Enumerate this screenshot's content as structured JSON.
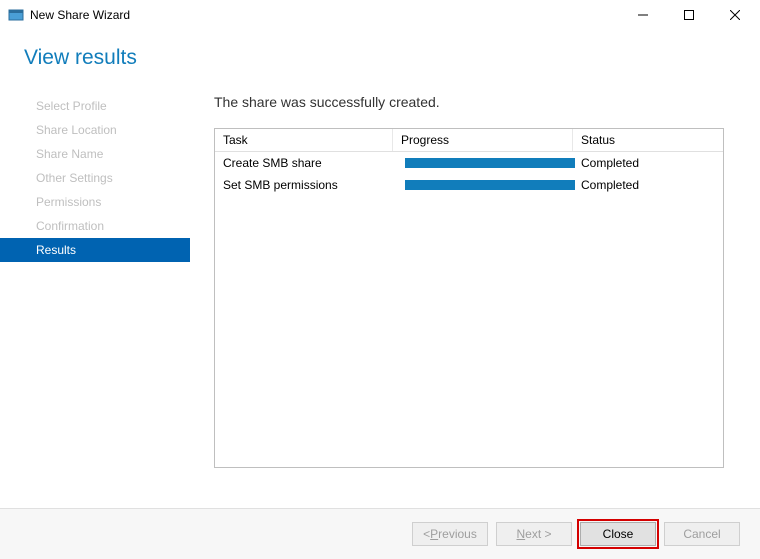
{
  "window": {
    "title": "New Share Wizard"
  },
  "heading": "View results",
  "sidebar": {
    "items": [
      {
        "label": "Select Profile"
      },
      {
        "label": "Share Location"
      },
      {
        "label": "Share Name"
      },
      {
        "label": "Other Settings"
      },
      {
        "label": "Permissions"
      },
      {
        "label": "Confirmation"
      },
      {
        "label": "Results"
      }
    ],
    "activeIndex": 6
  },
  "main": {
    "message": "The share was successfully created.",
    "columns": {
      "task": "Task",
      "progress": "Progress",
      "status": "Status"
    },
    "rows": [
      {
        "task": "Create SMB share",
        "status": "Completed"
      },
      {
        "task": "Set SMB permissions",
        "status": "Completed"
      }
    ]
  },
  "footer": {
    "previous_pre": "< ",
    "previous_ul": "P",
    "previous_rest": "revious",
    "next_ul": "N",
    "next_rest": "ext >",
    "close": "Close",
    "cancel": "Cancel"
  }
}
